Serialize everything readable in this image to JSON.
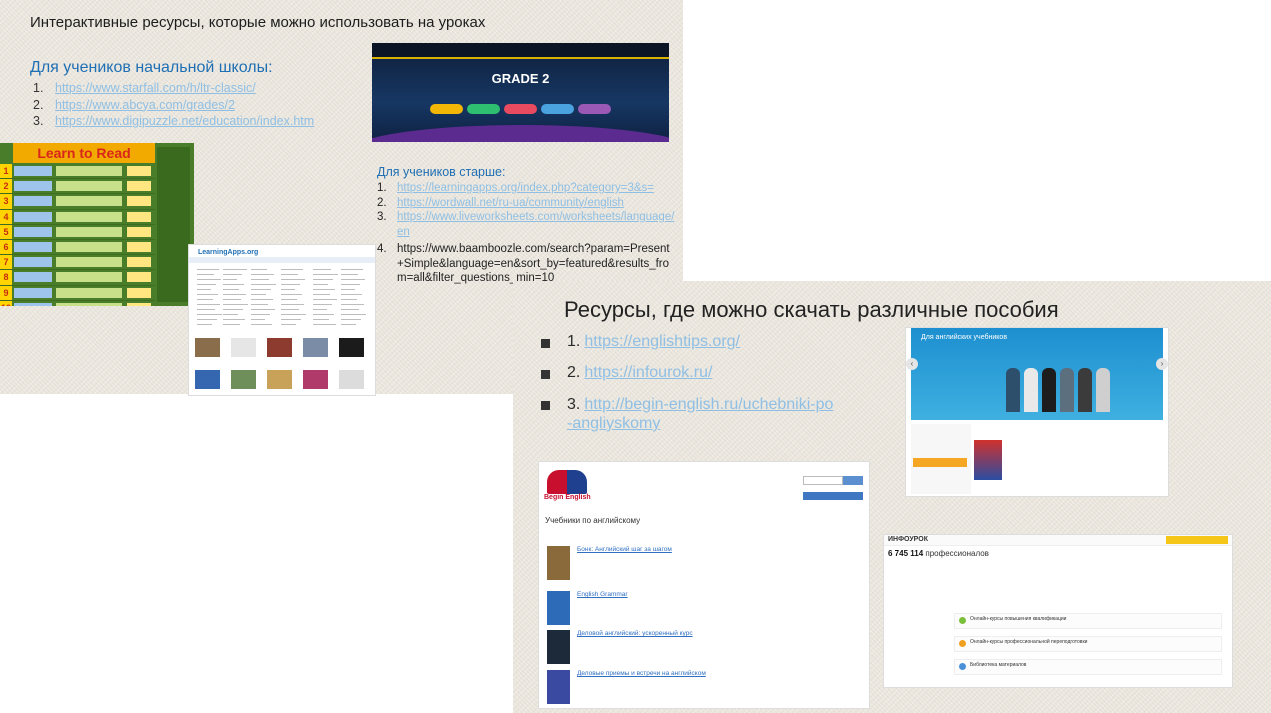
{
  "slide1": {
    "title": "Интерактивные ресурсы, которые можно использовать на уроках",
    "primary_heading": "Для учеников начальной школы:",
    "primary_links": [
      {
        "num": "1.",
        "url": "https://www.starfall.com/h/ltr-classic/"
      },
      {
        "num": "2.",
        "url": "https://www.abcya.com/grades/2"
      },
      {
        "num": "3.",
        "url": "https://www.digipuzzle.net/education/index.htm"
      }
    ],
    "older_heading": "Для учеников старше:",
    "older_links": [
      {
        "num": "1.",
        "url": "https://learningapps.org/index.php?category=3&s="
      },
      {
        "num": "2.",
        "url": "https://wordwall.net/ru-ua/community/english"
      },
      {
        "num": "3.",
        "url": "https://www.liveworksheets.com/worksheets/language/en"
      },
      {
        "num": "4.",
        "url": "https://www.baamboozle.com/search?param=Present+Simple&language=en&sort_by=featured&results_from=all&filter_questions_min=10"
      }
    ],
    "screens": {
      "grade_title": "GRADE 2",
      "learn_to_read": "Learn to Read",
      "learningapps_logo": "LearningApps.org",
      "row_numbers": [
        "1",
        "2",
        "3",
        "4",
        "5",
        "6",
        "7",
        "8",
        "9",
        "10"
      ]
    }
  },
  "slide2": {
    "title": "Ресурсы, где можно скачать различные пособия",
    "links": [
      {
        "num": "1.",
        "url": "https://englishtips.org/"
      },
      {
        "num": "2.",
        "url": "https://infourok.ru/"
      },
      {
        "num": "3.",
        "url": "http://begin-english.ru/uchebniki-po-angliyskomy"
      }
    ],
    "screens": {
      "englishtips_banner": "Для английских учебников",
      "begin_english_logo": "Begin English",
      "begin_english_section": "Учебники по английскому",
      "begin_english_books": [
        "Бонк: Английский шаг за шагом",
        "English Grammar",
        "Деловой английский: ускоренный курс",
        "Деловые приемы и встречи на английском"
      ],
      "infourok_logo": "ИНФОУРОК",
      "infourok_count": "6 745 114",
      "infourok_count_label": "профессионалов",
      "infourok_rows": [
        "Онлайн-курсы повышения квалификации",
        "Онлайн-курсы профессиональной переподготовки",
        "Библиотека материалов"
      ]
    }
  },
  "colors": {
    "heading_blue": "#1f6fb4",
    "link_blue": "#8fbfe4",
    "slide_bg": "#ebe7de"
  }
}
